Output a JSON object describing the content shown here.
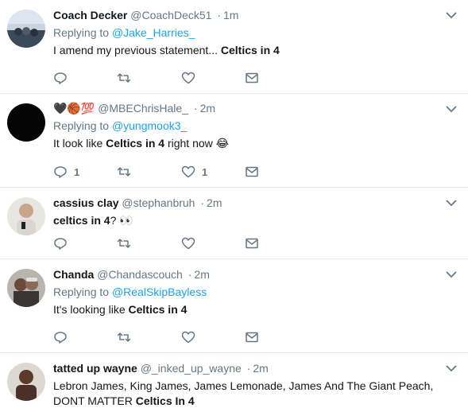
{
  "tweets": [
    {
      "name": "Coach Decker",
      "handle": "@CoachDeck51",
      "time": "1m",
      "replying_prefix": "Replying to ",
      "replying_to": "@Jake_Harries_",
      "text_before": "I amend my previous statement... ",
      "text_bold": "Celtics in 4",
      "text_after": "",
      "reply_count": "",
      "like_count": ""
    },
    {
      "name": "🖤🏀💯",
      "handle": "@MBEChrisHale_",
      "time": "2m",
      "replying_prefix": "Replying to ",
      "replying_to": "@yungmook3_",
      "text_before": "It look like ",
      "text_bold": "Celtics in 4",
      "text_after": " right now 😂",
      "reply_count": "1",
      "like_count": "1"
    },
    {
      "name": "cassius clay",
      "handle": "@stephanbruh",
      "time": "2m",
      "text_before": "",
      "text_bold": "celtics in 4",
      "text_after": "? 👀",
      "reply_count": "",
      "like_count": ""
    },
    {
      "name": "Chanda",
      "handle": "@Chandascouch",
      "time": "2m",
      "replying_prefix": "Replying to ",
      "replying_to": "@RealSkipBayless",
      "text_before": "It's looking like ",
      "text_bold": "Celtics in 4",
      "text_after": "",
      "reply_count": "",
      "like_count": ""
    },
    {
      "name": "tatted up wayne",
      "handle": "@_inked_up_wayne",
      "time": "2m",
      "text_before": "Lebron James, King James, James Lemonade, James And The Giant Peach, DONT MATTER ",
      "text_bold": "Celtics In 4",
      "text_after": ""
    }
  ],
  "separator": "·",
  "icons": [
    "reply-icon",
    "retweet-icon",
    "like-icon",
    "message-icon",
    "chevron-down-icon"
  ],
  "colors": {
    "link": "#1da1f2",
    "muted": "#657786",
    "text": "#14171a",
    "divider": "#e6ecf0"
  }
}
